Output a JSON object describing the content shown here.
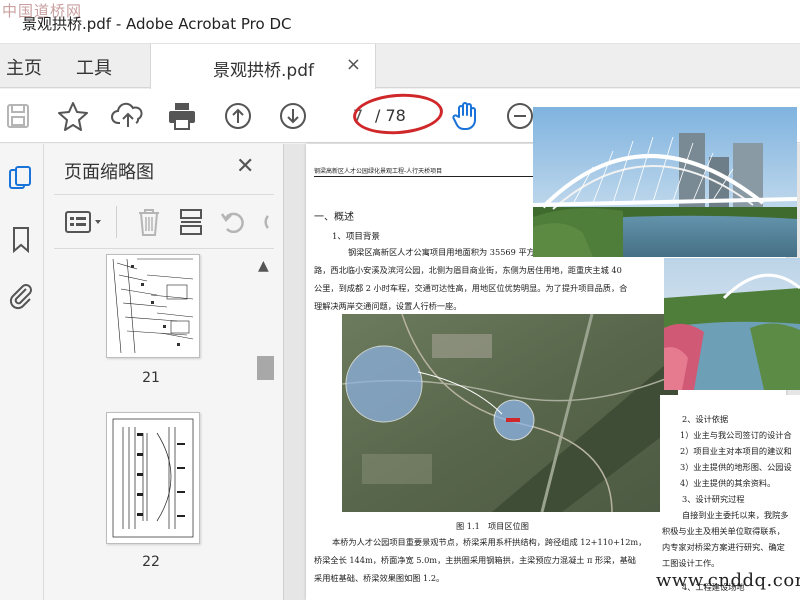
{
  "window": {
    "title": "景观拱桥.pdf - Adobe Acrobat Pro DC",
    "watermark_logo": "中国道桥网"
  },
  "menu": {
    "home": "主页",
    "tools": "工具"
  },
  "tab": {
    "label": "景观拱桥.pdf",
    "close": "×"
  },
  "toolbar": {
    "current_page": "7",
    "total_pages": "/ 78",
    "icons": [
      "save-icon",
      "bookmark-star-icon",
      "cloud-upload-icon",
      "print-icon",
      "page-up-icon",
      "page-down-icon",
      "hand-icon",
      "zoom-out-icon",
      "zoom-in-icon"
    ]
  },
  "sidebar": {
    "panel_title": "页面缩略图",
    "close": "✕",
    "thumbnails": [
      {
        "label": "21"
      },
      {
        "label": "22"
      }
    ]
  },
  "document": {
    "header": "钢梁高新区人才公园绿化景观工程-人行天桥项目",
    "section1": "一、概述",
    "sub1": "1、项目背景",
    "para1_line1": "钢梁区高新区人才公寓项目用地面积为 35569 平方米",
    "para1_line2": "路，西北临小安溪及滨河公园，北侧为眉目商业街，东侧为居住用地，距重庆主城 40",
    "para1_line3": "公里，到成都 2 小时车程，交通可达性高，用地区位优势明显。为了提升项目品质，合",
    "para1_line4": "理解决两岸交通问题，设置人行桥一座。",
    "figure_caption": "图 1.1　项目区位图",
    "para2_line1": "本桥为人才公园项目重要景观节点，桥梁采用系杆拱结构，跨径组成 12+110+12m，",
    "para2_line2": "桥梁全长 144m，桥面净宽 5.0m，主拱圈采用钢箱拱，主梁预应力混凝土 π 形梁，基础",
    "para2_line3": "采用桩基础、桥梁效果图如图 1.2。",
    "right_lines": [
      "2、设计依据",
      "1）业主与我公司签订的设计合",
      "2）项目业主对本项目的建议和",
      "3）业主提供的地形图、公园设",
      "4）业主提供的其余资料。",
      "3、设计研究过程",
      "自接到业主委托以来，我院多",
      "积极与业主及相关单位取得联系，",
      "内专家对桥梁方案进行研究、确定",
      "工图设计工作。",
      "4、工程建设场地"
    ],
    "site_watermark": "www.cnddq.com"
  },
  "colors": {
    "annotation_red": "#d0282a",
    "accent_blue": "#1a73d9",
    "icon_gray": "#555555"
  }
}
